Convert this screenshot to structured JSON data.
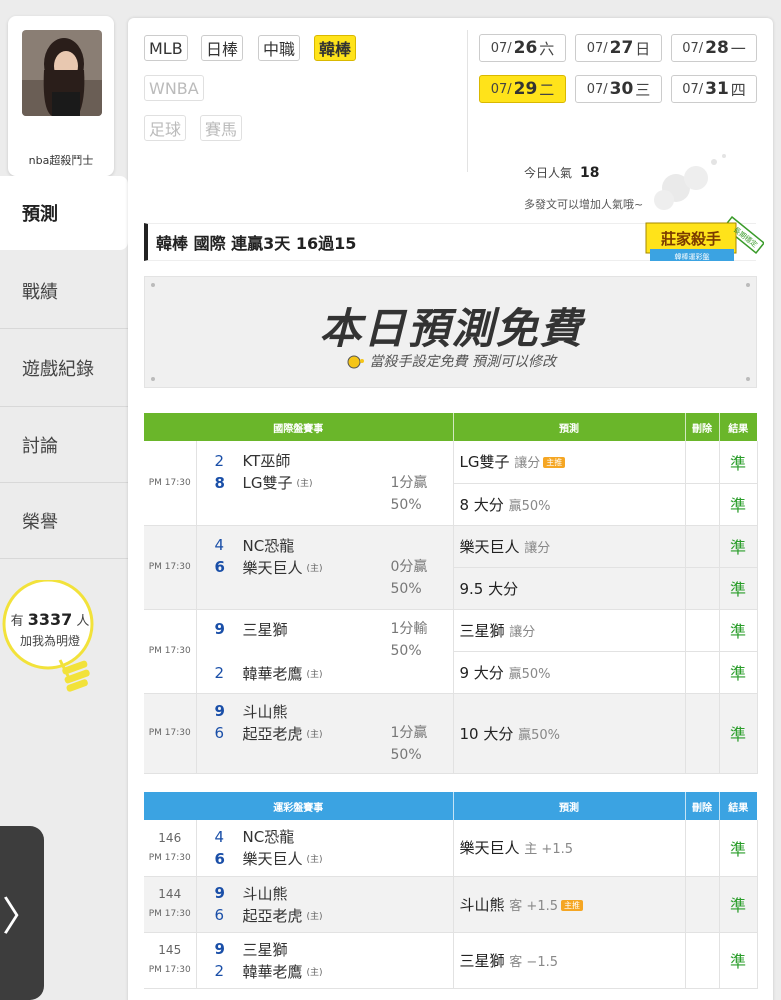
{
  "user": {
    "name": "nba超殺鬥士"
  },
  "nav": [
    "預測",
    "戰績",
    "遊戲紀錄",
    "討論",
    "榮譽"
  ],
  "followers": {
    "prefix": "有",
    "count": "3337",
    "suffix": "人",
    "sub": "加我為明燈"
  },
  "side_arrow": "〉",
  "leagues": [
    {
      "label": "MLB"
    },
    {
      "label": "日棒"
    },
    {
      "label": "中職"
    },
    {
      "label": "韓棒"
    },
    {
      "label": "WNBA"
    },
    {
      "label": "足球"
    },
    {
      "label": "賽馬"
    }
  ],
  "dates": [
    {
      "m": "07/",
      "d": "26",
      "w": "六"
    },
    {
      "m": "07/",
      "d": "27",
      "w": "日"
    },
    {
      "m": "07/",
      "d": "28",
      "w": "一"
    },
    {
      "m": "07/",
      "d": "29",
      "w": "二"
    },
    {
      "m": "07/",
      "d": "30",
      "w": "三"
    },
    {
      "m": "07/",
      "d": "31",
      "w": "四"
    }
  ],
  "popularity": {
    "label": "今日人氣",
    "value": "18",
    "hint": "多發文可以增加人氣哦~"
  },
  "headline": "韓棒 國際 連贏3天 16過15",
  "badge": {
    "title": "莊家殺手",
    "sub": "韓棒運彩盤",
    "ribbon": "長期穩定"
  },
  "free": {
    "title": "本日預測免費",
    "sub": "當殺手設定免費 預測可以修改"
  },
  "intl": {
    "headers": [
      "國際盤賽事",
      "預測",
      "刪除",
      "結果"
    ],
    "games": [
      {
        "time": "PM 17:30",
        "n1": "2",
        "t1": "KT巫師",
        "n2": "8",
        "t2": "LG雙子",
        "home": "(主)",
        "odds1": "1分贏",
        "odds2": "50%",
        "p1": "LG雙子",
        "p1s": "讓分",
        "p1hot": "主推",
        "r1": "準",
        "p2": "8 大分",
        "p2s": "贏50%",
        "r2": "準"
      },
      {
        "time": "PM 17:30",
        "n1": "4",
        "t1": "NC恐龍",
        "n2": "6",
        "t2": "樂天巨人",
        "home": "(主)",
        "odds1": "0分贏",
        "odds2": "50%",
        "p1": "樂天巨人",
        "p1s": "讓分",
        "r1": "準",
        "p2": "9.5 大分",
        "p2s": "",
        "r2": "準"
      },
      {
        "time": "PM 17:30",
        "n1": "9",
        "t1": "三星獅",
        "n2": "2",
        "t2": "韓華老鷹",
        "home": "(主)",
        "odds1": "1分輸",
        "odds2": "50%",
        "p1": "三星獅",
        "p1s": "讓分",
        "r1": "準",
        "p2": "9 大分",
        "p2s": "贏50%",
        "r2": "準"
      },
      {
        "time": "PM 17:30",
        "n1": "9",
        "t1": "斗山熊",
        "n2": "6",
        "t2": "起亞老虎",
        "home": "(主)",
        "odds1": "1分贏",
        "odds2": "50%",
        "p1": "10 大分",
        "p1s": "贏50%",
        "r1": "準"
      }
    ]
  },
  "lottery": {
    "headers": [
      "運彩盤賽事",
      "預測",
      "刪除",
      "結果"
    ],
    "games": [
      {
        "id": "146",
        "time": "PM 17:30",
        "n1": "4",
        "t1": "NC恐龍",
        "n2": "6",
        "t2": "樂天巨人",
        "home": "(主)",
        "p": "樂天巨人",
        "ps": "主 +1.5",
        "r": "準"
      },
      {
        "id": "144",
        "time": "PM 17:30",
        "n1": "9",
        "t1": "斗山熊",
        "n2": "6",
        "t2": "起亞老虎",
        "home": "(主)",
        "p": "斗山熊",
        "ps": "客 +1.5",
        "hot": "主推",
        "r": "準"
      },
      {
        "id": "145",
        "time": "PM 17:30",
        "n1": "9",
        "t1": "三星獅",
        "n2": "2",
        "t2": "韓華老鷹",
        "home": "(主)",
        "p": "三星獅",
        "ps": "客 −1.5",
        "r": "準"
      }
    ]
  }
}
